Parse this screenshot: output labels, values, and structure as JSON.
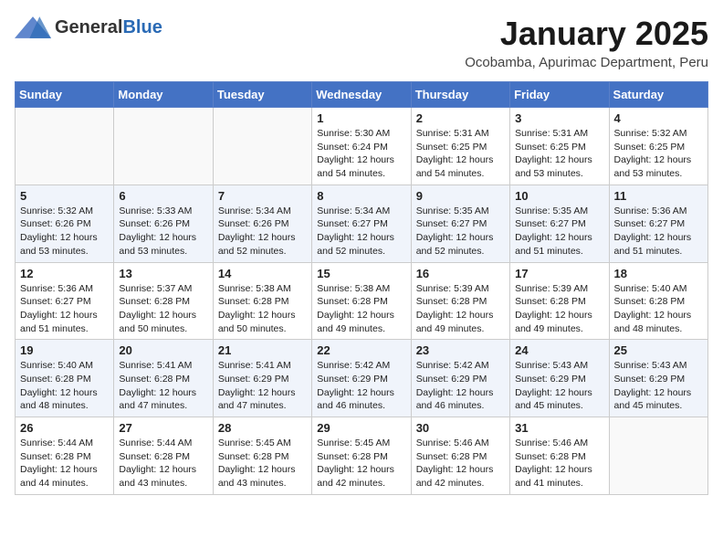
{
  "header": {
    "logo_general": "General",
    "logo_blue": "Blue",
    "title": "January 2025",
    "subtitle": "Ocobamba, Apurimac Department, Peru"
  },
  "days_of_week": [
    "Sunday",
    "Monday",
    "Tuesday",
    "Wednesday",
    "Thursday",
    "Friday",
    "Saturday"
  ],
  "weeks": [
    [
      {
        "day": "",
        "content": ""
      },
      {
        "day": "",
        "content": ""
      },
      {
        "day": "",
        "content": ""
      },
      {
        "day": "1",
        "content": "Sunrise: 5:30 AM\nSunset: 6:24 PM\nDaylight: 12 hours\nand 54 minutes."
      },
      {
        "day": "2",
        "content": "Sunrise: 5:31 AM\nSunset: 6:25 PM\nDaylight: 12 hours\nand 54 minutes."
      },
      {
        "day": "3",
        "content": "Sunrise: 5:31 AM\nSunset: 6:25 PM\nDaylight: 12 hours\nand 53 minutes."
      },
      {
        "day": "4",
        "content": "Sunrise: 5:32 AM\nSunset: 6:25 PM\nDaylight: 12 hours\nand 53 minutes."
      }
    ],
    [
      {
        "day": "5",
        "content": "Sunrise: 5:32 AM\nSunset: 6:26 PM\nDaylight: 12 hours\nand 53 minutes."
      },
      {
        "day": "6",
        "content": "Sunrise: 5:33 AM\nSunset: 6:26 PM\nDaylight: 12 hours\nand 53 minutes."
      },
      {
        "day": "7",
        "content": "Sunrise: 5:34 AM\nSunset: 6:26 PM\nDaylight: 12 hours\nand 52 minutes."
      },
      {
        "day": "8",
        "content": "Sunrise: 5:34 AM\nSunset: 6:27 PM\nDaylight: 12 hours\nand 52 minutes."
      },
      {
        "day": "9",
        "content": "Sunrise: 5:35 AM\nSunset: 6:27 PM\nDaylight: 12 hours\nand 52 minutes."
      },
      {
        "day": "10",
        "content": "Sunrise: 5:35 AM\nSunset: 6:27 PM\nDaylight: 12 hours\nand 51 minutes."
      },
      {
        "day": "11",
        "content": "Sunrise: 5:36 AM\nSunset: 6:27 PM\nDaylight: 12 hours\nand 51 minutes."
      }
    ],
    [
      {
        "day": "12",
        "content": "Sunrise: 5:36 AM\nSunset: 6:27 PM\nDaylight: 12 hours\nand 51 minutes."
      },
      {
        "day": "13",
        "content": "Sunrise: 5:37 AM\nSunset: 6:28 PM\nDaylight: 12 hours\nand 50 minutes."
      },
      {
        "day": "14",
        "content": "Sunrise: 5:38 AM\nSunset: 6:28 PM\nDaylight: 12 hours\nand 50 minutes."
      },
      {
        "day": "15",
        "content": "Sunrise: 5:38 AM\nSunset: 6:28 PM\nDaylight: 12 hours\nand 49 minutes."
      },
      {
        "day": "16",
        "content": "Sunrise: 5:39 AM\nSunset: 6:28 PM\nDaylight: 12 hours\nand 49 minutes."
      },
      {
        "day": "17",
        "content": "Sunrise: 5:39 AM\nSunset: 6:28 PM\nDaylight: 12 hours\nand 49 minutes."
      },
      {
        "day": "18",
        "content": "Sunrise: 5:40 AM\nSunset: 6:28 PM\nDaylight: 12 hours\nand 48 minutes."
      }
    ],
    [
      {
        "day": "19",
        "content": "Sunrise: 5:40 AM\nSunset: 6:28 PM\nDaylight: 12 hours\nand 48 minutes."
      },
      {
        "day": "20",
        "content": "Sunrise: 5:41 AM\nSunset: 6:28 PM\nDaylight: 12 hours\nand 47 minutes."
      },
      {
        "day": "21",
        "content": "Sunrise: 5:41 AM\nSunset: 6:29 PM\nDaylight: 12 hours\nand 47 minutes."
      },
      {
        "day": "22",
        "content": "Sunrise: 5:42 AM\nSunset: 6:29 PM\nDaylight: 12 hours\nand 46 minutes."
      },
      {
        "day": "23",
        "content": "Sunrise: 5:42 AM\nSunset: 6:29 PM\nDaylight: 12 hours\nand 46 minutes."
      },
      {
        "day": "24",
        "content": "Sunrise: 5:43 AM\nSunset: 6:29 PM\nDaylight: 12 hours\nand 45 minutes."
      },
      {
        "day": "25",
        "content": "Sunrise: 5:43 AM\nSunset: 6:29 PM\nDaylight: 12 hours\nand 45 minutes."
      }
    ],
    [
      {
        "day": "26",
        "content": "Sunrise: 5:44 AM\nSunset: 6:28 PM\nDaylight: 12 hours\nand 44 minutes."
      },
      {
        "day": "27",
        "content": "Sunrise: 5:44 AM\nSunset: 6:28 PM\nDaylight: 12 hours\nand 43 minutes."
      },
      {
        "day": "28",
        "content": "Sunrise: 5:45 AM\nSunset: 6:28 PM\nDaylight: 12 hours\nand 43 minutes."
      },
      {
        "day": "29",
        "content": "Sunrise: 5:45 AM\nSunset: 6:28 PM\nDaylight: 12 hours\nand 42 minutes."
      },
      {
        "day": "30",
        "content": "Sunrise: 5:46 AM\nSunset: 6:28 PM\nDaylight: 12 hours\nand 42 minutes."
      },
      {
        "day": "31",
        "content": "Sunrise: 5:46 AM\nSunset: 6:28 PM\nDaylight: 12 hours\nand 41 minutes."
      },
      {
        "day": "",
        "content": ""
      }
    ]
  ]
}
